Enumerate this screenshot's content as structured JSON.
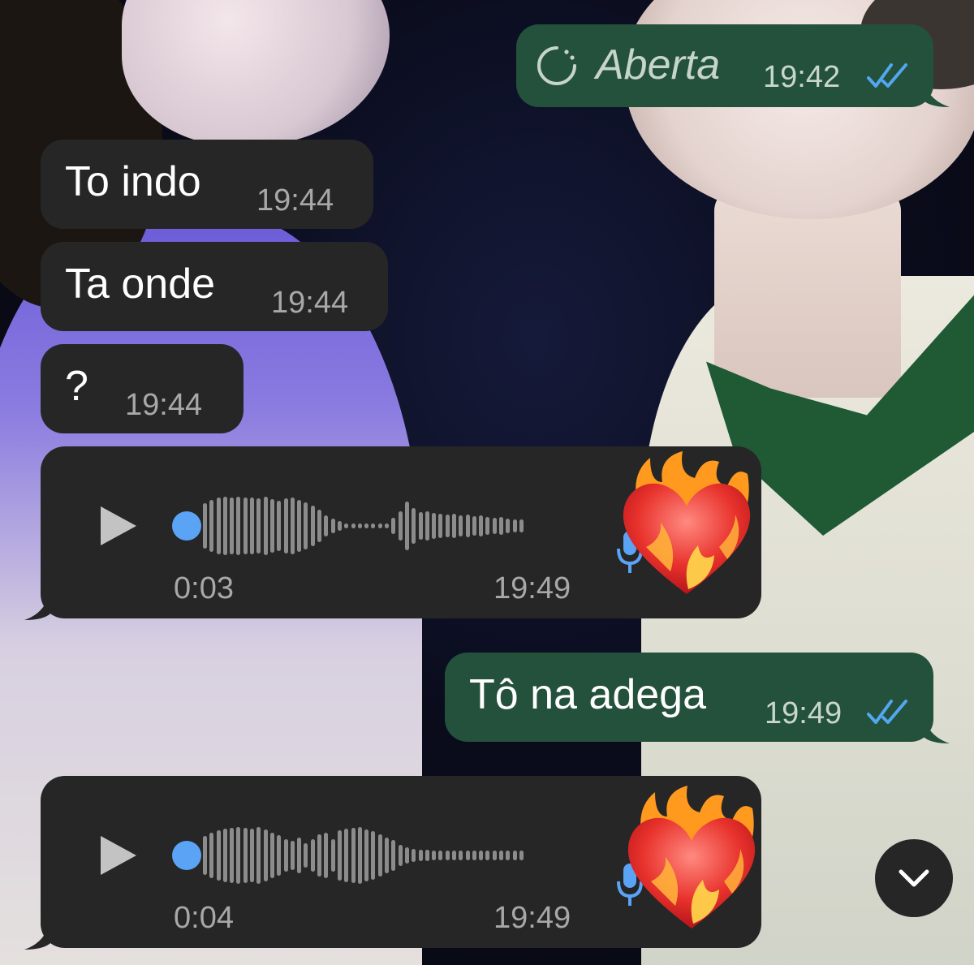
{
  "messages": [
    {
      "id": "m1",
      "direction": "outgoing",
      "type": "view-once",
      "text": "Aberta",
      "time": "19:42",
      "status": "read"
    },
    {
      "id": "m2",
      "direction": "incoming",
      "type": "text",
      "text": "To indo",
      "time": "19:44"
    },
    {
      "id": "m3",
      "direction": "incoming",
      "type": "text",
      "text": "Ta onde",
      "time": "19:44"
    },
    {
      "id": "m4",
      "direction": "incoming",
      "type": "text",
      "text": "?",
      "time": "19:44"
    },
    {
      "id": "m5",
      "direction": "incoming",
      "type": "voice",
      "duration": "0:03",
      "time": "19:49",
      "progress": 0,
      "reaction": "heart-on-fire"
    },
    {
      "id": "m6",
      "direction": "outgoing",
      "type": "text",
      "text": "Tô na adega",
      "time": "19:49",
      "status": "read"
    },
    {
      "id": "m7",
      "direction": "incoming",
      "type": "voice",
      "duration": "0:04",
      "time": "19:49",
      "progress": 0,
      "reaction": "heart-on-fire"
    }
  ],
  "icons": {
    "view_once": "view-once-icon",
    "read_ticks": "double-check-icon",
    "play": "play-icon",
    "mic": "microphone-icon",
    "scroll_down": "chevron-down-icon"
  },
  "colors": {
    "incoming_bubble": "#262626",
    "outgoing_bubble": "#23513b",
    "read_tick": "#53a6f0",
    "waveform": "#8c8c8c",
    "playhead": "#5ba3f5"
  }
}
